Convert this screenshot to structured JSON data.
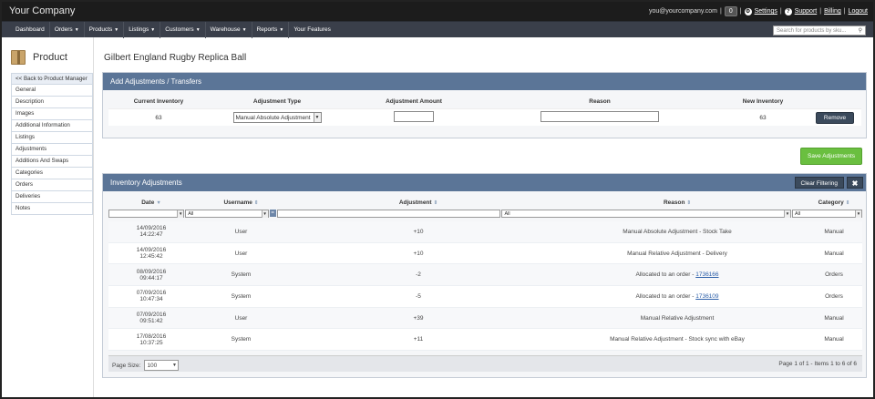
{
  "header": {
    "brand": "Your Company",
    "email": "you@yourcompany.com",
    "notification_count": "0",
    "settings": "Settings",
    "support": "Support",
    "billing": "Billing",
    "logout": "Logout",
    "sep": "|"
  },
  "nav": {
    "items": [
      "Dashboard",
      "Orders",
      "Products",
      "Listings",
      "Customers",
      "Warehouse",
      "Reports",
      "Your Features"
    ],
    "search_placeholder": "Search for products by sku..."
  },
  "sidebar": {
    "title": "Product",
    "items": [
      "<< Back to Product Manager",
      "General",
      "Description",
      "Images",
      "Additional Information",
      "Listings",
      "Adjustments",
      "Additions And Swaps",
      "Categories",
      "Orders",
      "Deliveries",
      "Notes"
    ]
  },
  "page": {
    "title": "Gilbert England Rugby Replica Ball"
  },
  "add_panel": {
    "title": "Add Adjustments / Transfers",
    "headers": [
      "Current Inventory",
      "Adjustment Type",
      "Adjustment Amount",
      "Reason",
      "New Inventory"
    ],
    "current_inventory": "63",
    "adjustment_type": "Manual Absolute Adjustment",
    "adjustment_amount": "",
    "reason": "",
    "new_inventory": "63",
    "remove_label": "Remove"
  },
  "save_label": "Save Adjustments",
  "inv_panel": {
    "title": "Inventory Adjustments",
    "clear_label": "Clear Filtering",
    "close_glyph": "✖",
    "headers": [
      "Date",
      "Username",
      "Adjustment",
      "Reason",
      "Category"
    ],
    "filters": {
      "username": "All",
      "reason": "All",
      "category": "All",
      "eq": "="
    },
    "rows": [
      {
        "date": "14/09/2016",
        "time": "14:22:47",
        "user": "User",
        "adj": "+10",
        "reason": "Manual Absolute Adjustment - Stock Take",
        "link": "",
        "category": "Manual"
      },
      {
        "date": "14/09/2016",
        "time": "12:45:42",
        "user": "User",
        "adj": "+10",
        "reason": "Manual Relative Adjustment - Delivery",
        "link": "",
        "category": "Manual"
      },
      {
        "date": "08/09/2016",
        "time": "09:44:17",
        "user": "System",
        "adj": "-2",
        "reason": "Allocated to an order - ",
        "link": "1736166",
        "category": "Orders"
      },
      {
        "date": "07/09/2016",
        "time": "10:47:34",
        "user": "System",
        "adj": "-5",
        "reason": "Allocated to an order - ",
        "link": "1736109",
        "category": "Orders"
      },
      {
        "date": "07/09/2016",
        "time": "09:51:42",
        "user": "User",
        "adj": "+39",
        "reason": "Manual Relative Adjustment",
        "link": "",
        "category": "Manual"
      },
      {
        "date": "17/08/2016",
        "time": "10:37:25",
        "user": "System",
        "adj": "+11",
        "reason": "Manual Relative Adjustment - Stock sync with eBay",
        "link": "",
        "category": "Manual"
      }
    ],
    "page_size_label": "Page Size:",
    "page_size": "100",
    "page_info": "Page 1 of 1  -  Items 1 to 6 of 6"
  },
  "colors": {
    "panel_header": "#5b7597",
    "save": "#6abf40",
    "dark_button": "#3b4a5c",
    "topbar": "#1c1c1c",
    "navbar": "#3a3f4a"
  }
}
